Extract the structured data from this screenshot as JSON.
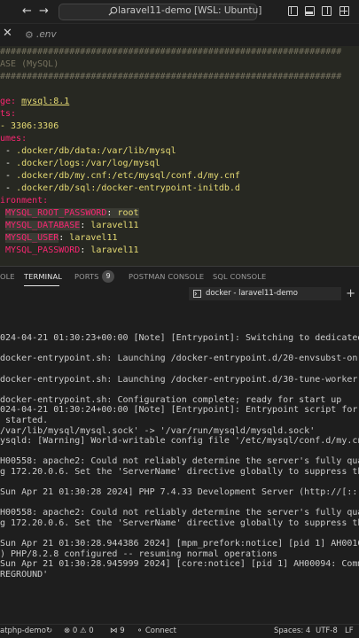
{
  "titlebar": {
    "search_text": "laravel11-demo [WSL: Ubuntu]",
    "back_icon": "arrow-left-icon",
    "forward_icon": "arrow-right-icon"
  },
  "tabs": {
    "active_tab_label": ".env"
  },
  "editor": {
    "lines": [
      {
        "text": "################################################################",
        "cls": "c"
      },
      {
        "text": "ASE (MySQL)",
        "cls": "c"
      },
      {
        "text": "################################################################",
        "cls": "c"
      }
    ],
    "image_key": "ge:",
    "image_value": "mysql:8.1",
    "ports_key": "ts:",
    "ports_item": "- 3306:3306",
    "volumes_key": "umes:",
    "volume_items": [
      ".docker/db/data:/var/lib/mysql",
      ".docker/logs:/var/log/mysql",
      ".docker/db/my.cnf:/etc/mysql/conf.d/my.cnf",
      ".docker/db/sql:/docker-entrypoint-initdb.d"
    ],
    "env_key": "ironment:",
    "env_items": [
      {
        "key": "MYSQL_ROOT_PASSWORD",
        "value": "root"
      },
      {
        "key": "MYSQL_DATABASE",
        "value": "laravel11"
      },
      {
        "key": "MYSQL_USER",
        "value": "laravel11"
      },
      {
        "key": "MYSQL_PASSWORD",
        "value": "laravel11"
      }
    ]
  },
  "panel": {
    "tabs": [
      "OLE",
      "TERMINAL",
      "PORTS",
      "POSTMAN CONSOLE",
      "SQL CONSOLE"
    ],
    "ports_count": "9",
    "terminal_instance": "docker - laravel11-demo"
  },
  "terminal": {
    "lines": [
      "",
      "",
      "024-04-21 01:30:23+00:00 [Note] [Entrypoint]: Switching to dedicated",
      "",
      "docker-entrypoint.sh: Launching /docker-entrypoint.d/20-envsubst-on-",
      "",
      "docker-entrypoint.sh: Launching /docker-entrypoint.d/30-tune-worker-",
      "",
      "docker-entrypoint.sh: Configuration complete; ready for start up",
      "024-04-21 01:30:24+00:00 [Note] [Entrypoint]: Entrypoint script for",
      " started.",
      "/var/lib/mysql/mysql.sock' -> '/var/run/mysqld/mysqld.sock'",
      "ysqld: [Warning] World-writable config file '/etc/mysql/conf.d/my.cn",
      "",
      "H00558: apache2: Could not reliably determine the server's fully qua",
      "g 172.20.0.6. Set the 'ServerName' directive globally to suppress th",
      "",
      "Sun Apr 21 01:30:28 2024] PHP 7.4.33 Development Server (http://[::]",
      "",
      "H00558: apache2: Could not reliably determine the server's fully qua",
      "g 172.20.0.6. Set the 'ServerName' directive globally to suppress th",
      "",
      "Sun Apr 21 01:30:28.944386 2024] [mpm_prefork:notice] [pid 1] AH0016",
      ") PHP/8.2.8 configured -- resuming normal operations",
      "Sun Apr 21 01:30:28.945999 2024] [core:notice] [pid 1] AH00094: Comm",
      "REGROUND'"
    ]
  },
  "statusbar": {
    "branch": "atphp-demo",
    "errors": "0",
    "warnings": "0",
    "ports": "9",
    "connect": "Connect",
    "spaces": "Spaces: 4",
    "encoding": "UTF-8",
    "eol": "LF"
  },
  "colors": {
    "editor_bg": "#272822",
    "keyword": "#f92672",
    "string": "#e6db74",
    "comment": "#75715e",
    "panel_bg": "#1e1e1e"
  }
}
